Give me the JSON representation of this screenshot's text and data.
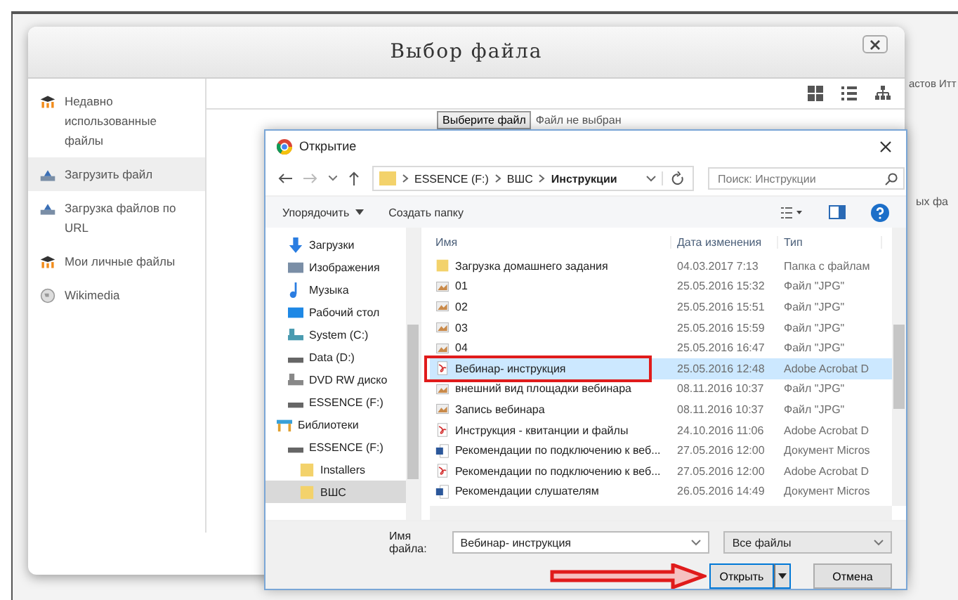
{
  "background_page": {
    "fragments": [
      "астов Итт",
      "ых фа"
    ]
  },
  "file_picker": {
    "title": "Выбор файла",
    "sidebar": [
      {
        "label": "Недавно использованные файлы",
        "kind": "repo",
        "selected": false
      },
      {
        "label": "Загрузить файл",
        "kind": "upload",
        "selected": true
      },
      {
        "label": "Загрузка файлов по URL",
        "kind": "upload",
        "selected": false
      },
      {
        "label": "Мои личные файлы",
        "kind": "repo",
        "selected": false
      },
      {
        "label": "Wikimedia",
        "kind": "globe",
        "selected": false
      }
    ],
    "upload": {
      "button": "Выберите файл",
      "status": "Файл не выбран"
    }
  },
  "open_dialog": {
    "title": "Открытие",
    "breadcrumb": [
      "ESSENCE (F:)",
      "ВШС",
      "Инструкции"
    ],
    "search": {
      "placeholder": "Поиск: Инструкции"
    },
    "toolbar": [
      "Упорядочить",
      "Создать папку"
    ],
    "nav_pane": [
      {
        "label": "Загрузки",
        "kind": "download",
        "selected": false
      },
      {
        "label": "Изображения",
        "kind": "pictures",
        "selected": false
      },
      {
        "label": "Музыка",
        "kind": "music",
        "selected": false
      },
      {
        "label": "Рабочий стол",
        "kind": "desktop",
        "selected": false
      },
      {
        "label": "System (C:)",
        "kind": "system",
        "selected": false
      },
      {
        "label": "Data (D:)",
        "kind": "drive",
        "selected": false
      },
      {
        "label": "DVD RW диско",
        "kind": "dvd",
        "selected": false
      },
      {
        "label": "ESSENCE (F:)",
        "kind": "drive",
        "selected": false
      },
      {
        "label": "Библиотеки",
        "kind": "library",
        "selected": false
      },
      {
        "label": "ESSENCE (F:)",
        "kind": "drive",
        "selected": false,
        "children": [
          {
            "label": "Installers",
            "kind": "folder",
            "selected": false
          },
          {
            "label": "ВШС",
            "kind": "folder",
            "selected": true
          }
        ]
      }
    ],
    "columns": [
      "Имя",
      "Дата изменения",
      "Тип"
    ],
    "files": [
      {
        "name": "Загрузка домашнего задания",
        "date": "04.03.2017 7:13",
        "type": "Папка с файлам",
        "kind": "folder",
        "selected": false
      },
      {
        "name": "01",
        "date": "25.05.2016 15:32",
        "type": "Файл \"JPG\"",
        "kind": "image",
        "selected": false
      },
      {
        "name": "02",
        "date": "25.05.2016 15:51",
        "type": "Файл \"JPG\"",
        "kind": "image",
        "selected": false
      },
      {
        "name": "03",
        "date": "25.05.2016 15:59",
        "type": "Файл \"JPG\"",
        "kind": "image",
        "selected": false
      },
      {
        "name": "04",
        "date": "25.05.2016 16:47",
        "type": "Файл \"JPG\"",
        "kind": "image",
        "selected": false
      },
      {
        "name": "Вебинар- инструкция",
        "date": "25.05.2016 12:48",
        "type": "Adobe Acrobat D",
        "kind": "pdf",
        "selected": true
      },
      {
        "name": "внешний вид площадки вебинара",
        "date": "08.11.2016 10:37",
        "type": "Файл \"JPG\"",
        "kind": "image",
        "selected": false
      },
      {
        "name": "Запись вебинара",
        "date": "08.11.2016 10:37",
        "type": "Файл \"JPG\"",
        "kind": "image",
        "selected": false
      },
      {
        "name": "Инструкция - квитанции и файлы",
        "date": "24.10.2016 11:06",
        "type": "Adobe Acrobat D",
        "kind": "pdf",
        "selected": false
      },
      {
        "name": "Рекомендации по подключению к веб...",
        "date": "27.05.2016 12:00",
        "type": "Документ Micros",
        "kind": "doc",
        "selected": false
      },
      {
        "name": "Рекомендации по подключению к веб...",
        "date": "27.05.2016 12:00",
        "type": "Adobe Acrobat D",
        "kind": "pdf",
        "selected": false
      },
      {
        "name": "Рекомендации слушателям",
        "date": "26.05.2016 14:49",
        "type": "Документ Micros",
        "kind": "doc",
        "selected": false
      }
    ],
    "file_name": {
      "label": "Имя файла:",
      "value": "Вебинар- инструкция"
    },
    "filter": "Все файлы",
    "buttons": [
      "Открыть",
      "Отмена"
    ]
  }
}
